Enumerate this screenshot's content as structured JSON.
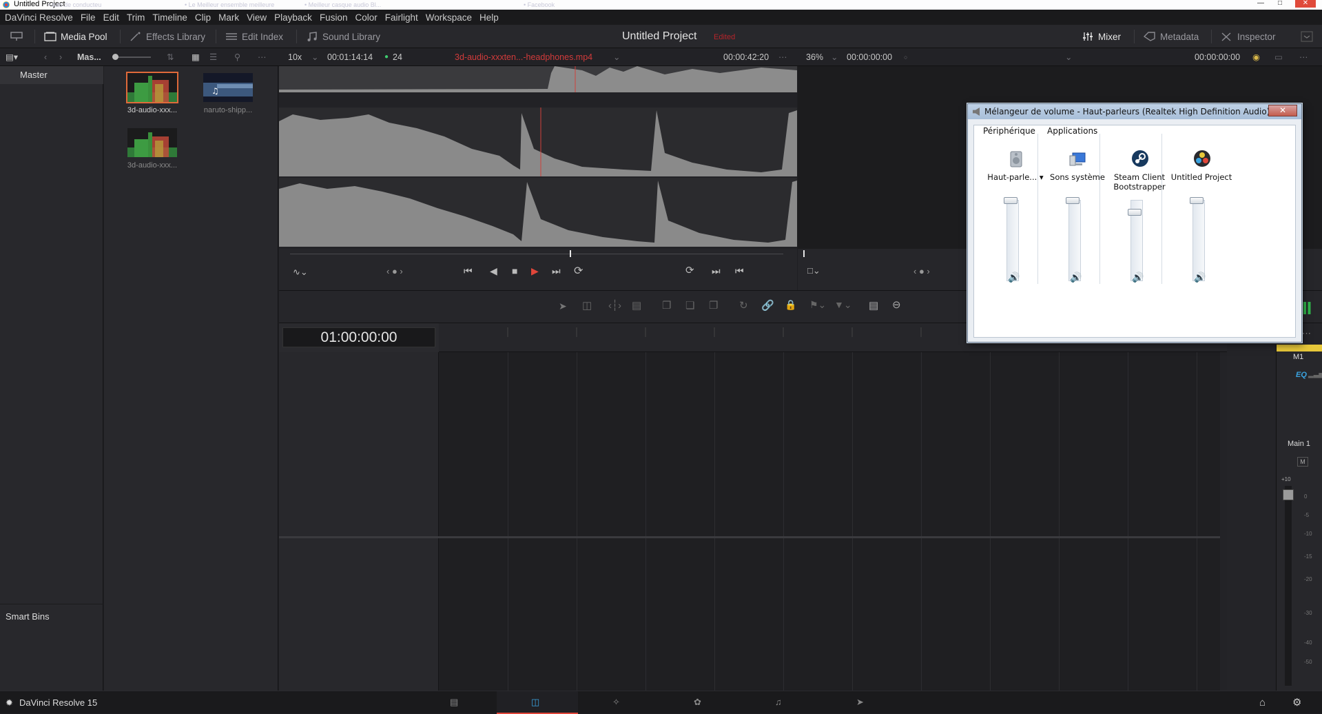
{
  "window": {
    "title": "Untitled Project",
    "ghost_tabs": [
      "• tuto de conducteu",
      "• Le Meilleur ensemble meilleure",
      "• Meilleur casque audio Bl...",
      "• Facebook"
    ]
  },
  "menu": [
    "DaVinci Resolve",
    "File",
    "Edit",
    "Trim",
    "Timeline",
    "Clip",
    "Mark",
    "View",
    "Playback",
    "Fusion",
    "Color",
    "Fairlight",
    "Workspace",
    "Help"
  ],
  "toolbar": {
    "media_pool": "Media Pool",
    "effects_library": "Effects Library",
    "edit_index": "Edit Index",
    "sound_library": "Sound Library",
    "project_title": "Untitled Project",
    "edited": "Edited",
    "mixer": "Mixer",
    "metadata": "Metadata",
    "inspector": "Inspector"
  },
  "subbar": {
    "bin_label": "Mas...",
    "zoom": "10x",
    "src_timecode": "00:01:14:14",
    "fps": "24",
    "clip_name": "3d-audio-xxxten...-headphones.mp4",
    "src_duration": "00:00:42:20",
    "rec_zoom": "36%",
    "rec_timecode": "00:00:00:00",
    "rec_timecode_right": "00:00:00:00"
  },
  "bins": {
    "master": "Master",
    "smart_bins": "Smart Bins"
  },
  "clips": [
    {
      "name": "3d-audio-xxx...",
      "selected": true,
      "kind": "audio"
    },
    {
      "name": "naruto-shipp...",
      "selected": false,
      "kind": "video"
    },
    {
      "name": "3d-audio-xxx...",
      "selected": false,
      "kind": "audio"
    }
  ],
  "timeline": {
    "timecode": "01:00:00:00"
  },
  "mixer_panel": {
    "m1": "M1",
    "eq": "EQ",
    "main1": "Main 1",
    "mute": "M",
    "scale": [
      "+10",
      "0",
      "-5",
      "-10",
      "-15",
      "-20",
      "-30",
      "-40",
      "-50"
    ]
  },
  "pagebar": {
    "brand": "DaVinci Resolve 15"
  },
  "volume_mixer": {
    "title": "Mélangeur de volume - Haut-parleurs (Realtek High Definition Audio)",
    "close": "✕",
    "device_label": "Périphérique",
    "apps_label": "Applications",
    "columns": [
      {
        "name": "Haut-parle...",
        "icon": "speaker-device-icon",
        "level": 1.0,
        "dropdown": true
      },
      {
        "name": "Sons système",
        "icon": "system-sounds-icon",
        "level": 1.0
      },
      {
        "name": "Steam Client Bootstrapper",
        "icon": "steam-icon",
        "level": 0.85
      },
      {
        "name": "Untitled Project",
        "icon": "davinci-resolve-icon",
        "level": 1.0
      }
    ]
  },
  "colors": {
    "accent_red": "#e0463a",
    "edited_red": "#b5242a",
    "clip_name_red": "#d23b3b",
    "selection_orange": "#e06a3a"
  }
}
